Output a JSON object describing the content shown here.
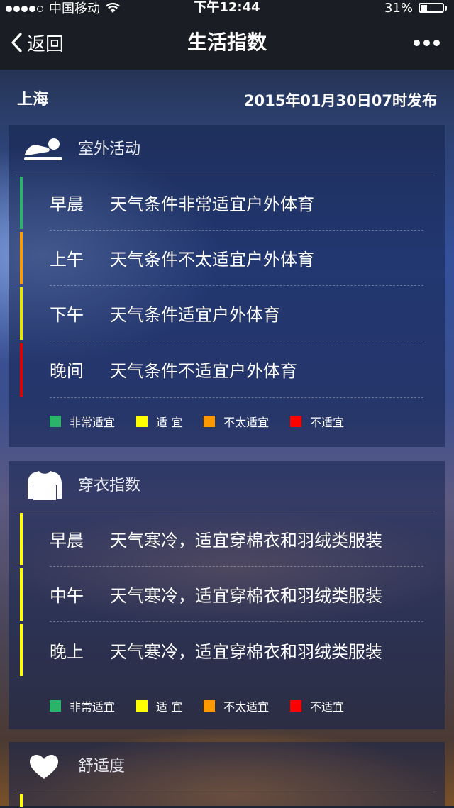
{
  "status_bar": {
    "carrier": "中国移动",
    "time": "下午12:44",
    "battery": "31%",
    "battery_level": 0.31,
    "signal_bars": 4,
    "signal_total": 5
  },
  "nav": {
    "back_label": "返回",
    "title": "生活指数"
  },
  "meta": {
    "city": "上海",
    "publish_time": "2015年01月30日07时发布"
  },
  "colors": {
    "very_suitable": "#2bb36a",
    "suitable": "#ffff00",
    "less_suitable": "#ff9900",
    "unsuitable": "#ff0000",
    "header_bg": "#1a1d23"
  },
  "legend": [
    {
      "label": "非常适宜",
      "color": "#2bb36a"
    },
    {
      "label": "适 宜",
      "color": "#ffff00"
    },
    {
      "label": "不太适宜",
      "color": "#ff9900"
    },
    {
      "label": "不适宜",
      "color": "#ff0000"
    }
  ],
  "cards": [
    {
      "title": "室外活动",
      "icon": "outdoor-activity-icon",
      "rows": [
        {
          "label": "早晨",
          "text": "天气条件非常适宜户外体育",
          "color": "#2bb36a"
        },
        {
          "label": "上午",
          "text": "天气条件不太适宜户外体育",
          "color": "#ff9900"
        },
        {
          "label": "下午",
          "text": "天气条件适宜户外体育",
          "color": "#e6e600"
        },
        {
          "label": "晚间",
          "text": "天气条件不适宜户外体育",
          "color": "#e00000"
        }
      ]
    },
    {
      "title": "穿衣指数",
      "icon": "clothing-icon",
      "rows": [
        {
          "label": "早晨",
          "text": "天气寒冷，适宜穿棉衣和羽绒类服装",
          "color": "#ffff00"
        },
        {
          "label": "中午",
          "text": "天气寒冷，适宜穿棉衣和羽绒类服装",
          "color": "#ffff00"
        },
        {
          "label": "晚上",
          "text": "天气寒冷，适宜穿棉衣和羽绒类服装",
          "color": "#ffff00"
        }
      ]
    },
    {
      "title": "舒适度",
      "icon": "heart-icon",
      "rows": []
    }
  ]
}
